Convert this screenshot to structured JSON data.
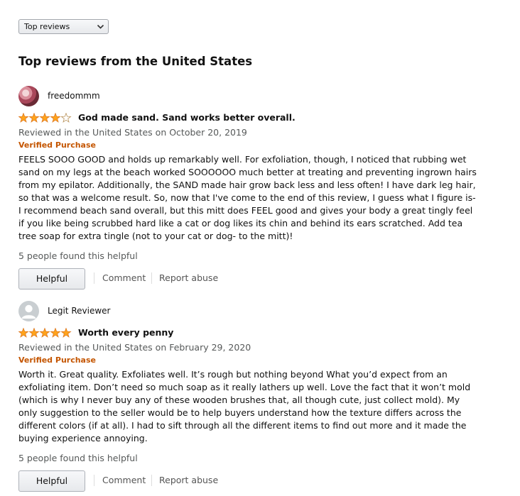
{
  "sort": {
    "selected": "Top reviews",
    "icon": "chevron-down-icon"
  },
  "section_title": "Top reviews from the United States",
  "colors": {
    "star": "#ffa41c",
    "verified": "#c45500",
    "muted": "#565959"
  },
  "reviews": [
    {
      "reviewer": "freedommm",
      "rating": 4,
      "title": "God made sand. Sand works better overall.",
      "date": "Reviewed in the United States on October 20, 2019",
      "verified": "Verified Purchase",
      "body": "FEELS SOOO GOOD and holds up remarkably well. For exfoliation, though, I noticed that rubbing wet sand on my legs at the beach worked SOOOOOO much better at treating and preventing ingrown hairs from my epilator. Additionally, the SAND made hair grow back less and less often! I have dark leg hair, so that was a welcome result. So, now that I've come to the end of this review, I guess what I figure is- I recommend beach sand overall, but this mitt does FEEL good and gives your body a great tingly feel if you like being scrubbed hard like a cat or dog likes its chin and behind its ears scratched. Add tea tree soap for extra tingle (not to your cat or dog- to the mitt)!",
      "helpful_count": "5 people found this helpful",
      "helpful_label": "Helpful",
      "comment_label": "Comment",
      "report_label": "Report abuse"
    },
    {
      "reviewer": "Legit Reviewer",
      "rating": 5,
      "title": "Worth every penny",
      "date": "Reviewed in the United States on February 29, 2020",
      "verified": "Verified Purchase",
      "body": "Worth it. Great quality. Exfoliates well. It’s rough but nothing beyond What you’d expect from an exfoliating item. Don’t need so much soap as it really lathers up well. Love the fact that it won’t mold (which is why I never buy any of these wooden brushes that, all though cute, just collect mold). My only suggestion to the seller would be to help buyers understand how the texture differs across the different colors (if at all). I had to sift through all the different items to find out more and it made the buying experience annoying.",
      "helpful_count": "5 people found this helpful",
      "helpful_label": "Helpful",
      "comment_label": "Comment",
      "report_label": "Report abuse"
    }
  ]
}
